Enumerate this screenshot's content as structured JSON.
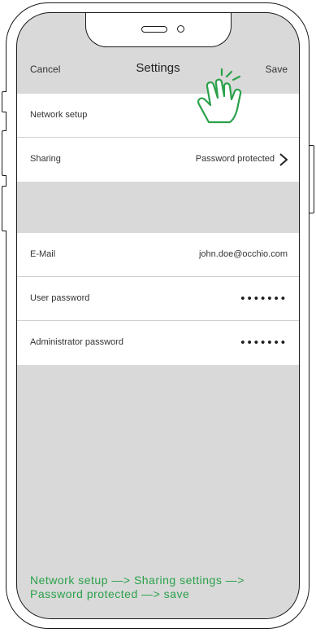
{
  "navbar": {
    "cancel_label": "Cancel",
    "title": "Settings",
    "save_label": "Save"
  },
  "group1": {
    "items": [
      {
        "label": "Network setup",
        "value": ""
      },
      {
        "label": "Sharing",
        "value": "Password protected"
      }
    ]
  },
  "group2": {
    "items": [
      {
        "label": "E-Mail",
        "value": "john.doe@occhio.com"
      },
      {
        "label": "User password",
        "value": "•••••••"
      },
      {
        "label": "Administrator password",
        "value": "•••••••"
      }
    ]
  },
  "instruction": {
    "line1": "Network setup —> Sharing settings —>",
    "line2": "Password protected —> save"
  },
  "colors": {
    "accent_green": "#2aa14a",
    "screen_bg": "#d9d9d9"
  },
  "icons": {
    "disclosure": "chevron-right-icon",
    "pointer": "tap-hand-icon"
  }
}
